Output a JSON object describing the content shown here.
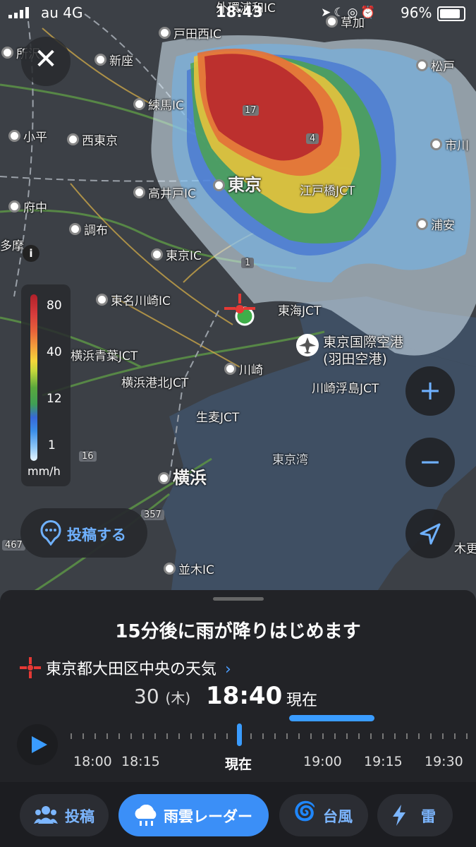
{
  "status_bar": {
    "carrier": "au 4G",
    "time": "18:43",
    "battery": "96%"
  },
  "map": {
    "labels": [
      {
        "text": "所沢",
        "kind": "city"
      },
      {
        "text": "新座",
        "kind": "city"
      },
      {
        "text": "戸田西IC",
        "kind": "ic"
      },
      {
        "text": "外環浦和IC",
        "kind": "ic"
      },
      {
        "text": "草加",
        "kind": "city"
      },
      {
        "text": "松戸",
        "kind": "city"
      },
      {
        "text": "練馬IC",
        "kind": "ic"
      },
      {
        "text": "小平",
        "kind": "city"
      },
      {
        "text": "西東京",
        "kind": "city"
      },
      {
        "text": "市川",
        "kind": "city"
      },
      {
        "text": "東京",
        "kind": "major"
      },
      {
        "text": "江戸橋JCT",
        "kind": "jct"
      },
      {
        "text": "高井戸IC",
        "kind": "ic"
      },
      {
        "text": "府中",
        "kind": "city"
      },
      {
        "text": "調布",
        "kind": "city"
      },
      {
        "text": "浦安",
        "kind": "city"
      },
      {
        "text": "多摩",
        "kind": "city"
      },
      {
        "text": "東京IC",
        "kind": "ic"
      },
      {
        "text": "東名川崎IC",
        "kind": "ic"
      },
      {
        "text": "東海JCT",
        "kind": "jct"
      },
      {
        "text": "東京国際空港",
        "kind": "airport"
      },
      {
        "text": "(羽田空港)",
        "kind": "airport"
      },
      {
        "text": "横浜青葉JCT",
        "kind": "jct"
      },
      {
        "text": "川崎",
        "kind": "city"
      },
      {
        "text": "横浜港北JCT",
        "kind": "jct"
      },
      {
        "text": "川崎浮島JCT",
        "kind": "jct"
      },
      {
        "text": "生麦JCT",
        "kind": "jct"
      },
      {
        "text": "東京湾",
        "kind": "water"
      },
      {
        "text": "横浜",
        "kind": "major"
      },
      {
        "text": "並木IC",
        "kind": "ic"
      },
      {
        "text": "木更",
        "kind": "city"
      },
      {
        "text": "17",
        "kind": "route"
      },
      {
        "text": "4",
        "kind": "route"
      },
      {
        "text": "16",
        "kind": "route"
      },
      {
        "text": "357",
        "kind": "route"
      },
      {
        "text": "467",
        "kind": "route"
      },
      {
        "text": "1",
        "kind": "route"
      }
    ],
    "legend": {
      "values": [
        "80",
        "40",
        "12",
        "1"
      ],
      "unit": "mm/h"
    },
    "info_icon": "i",
    "post_button_label": "投稿する",
    "zoom_in": "+",
    "zoom_out": "−"
  },
  "sheet": {
    "headline": "15分後に雨が降りはじめます",
    "location": "東京都大田区中央の天気",
    "date_day": "30",
    "date_weekday": "(木)",
    "time": "18:40",
    "now_label": "現在",
    "timeline_labels": [
      "18:00",
      "18:15",
      "現在",
      "19:00",
      "19:15",
      "19:30"
    ]
  },
  "tabs": [
    {
      "label": "投稿",
      "icon": "users-icon",
      "active": false
    },
    {
      "label": "雨雲レーダー",
      "icon": "rain-cloud-icon",
      "active": true
    },
    {
      "label": "台風",
      "icon": "typhoon-icon",
      "active": false
    },
    {
      "label": "雷",
      "icon": "lightning-icon",
      "active": false
    }
  ],
  "colors": {
    "accent": "#3b8ff7",
    "radar_heavy": "#b0202a",
    "sea": "#3f4f63",
    "land": "#3c4046"
  }
}
